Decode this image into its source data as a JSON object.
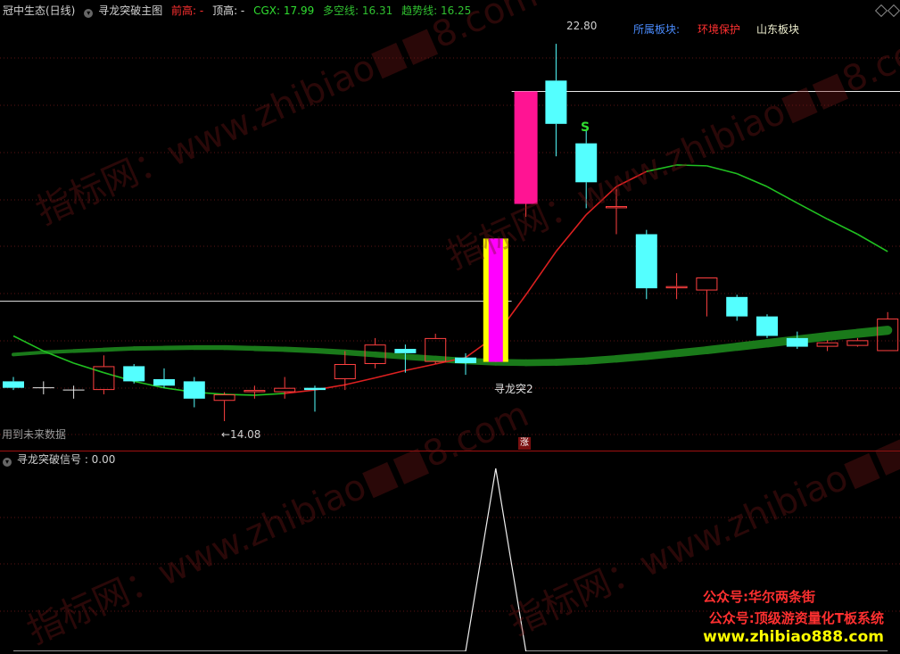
{
  "header": {
    "stock_name": "冠中生态(日线)",
    "indicator_name": "寻龙突破主图",
    "prev_high": "前高: -",
    "top_high": "顶高: -",
    "cgx": "CGX: 17.99",
    "long_short": "多空线: 16.31",
    "trend": "趋势线: 16.25"
  },
  "sectors": {
    "label": "所属板块:",
    "items": [
      "环境保护",
      "山东板块"
    ]
  },
  "main_panel": {
    "future_note": "用到未来数据",
    "high_label": "22.80",
    "low_label": "←14.08",
    "signal_label": "寻龙突2",
    "s_mark": "S",
    "zhang_mark": "涨"
  },
  "sub_panel": {
    "title": "寻龙突破信号 : 0.00"
  },
  "promo": {
    "line1": "公众号:华尔两条街",
    "line2": "公众号:顶级游资量化T板系统",
    "line3": "www.zhibiao888.com"
  },
  "watermarks": [
    "指标网：www.zhibiao■■8.com",
    "指标网：www.zhibiao■■8.com",
    "指标网：www.zhibiao■■8.com",
    "指标网：www.zhibiao■■8.com"
  ],
  "colors": {
    "up": "#ff4040",
    "down": "#54ffff",
    "pink": "#ff1493",
    "yellow": "#ffff00",
    "magenta": "#ff00ff",
    "trend_green": "#1a7a1a",
    "line_red": "#dd2020",
    "line_green": "#20c020"
  },
  "chart_data": {
    "type": "candlestick",
    "price_axis": {
      "min": 13.4,
      "max": 23.4
    },
    "candles": [
      {
        "o": 15.0,
        "h": 15.1,
        "l": 14.8,
        "c": 14.85,
        "color": "down"
      },
      {
        "o": 14.88,
        "h": 15.0,
        "l": 14.7,
        "c": 14.85,
        "color": "cross"
      },
      {
        "o": 14.85,
        "h": 14.9,
        "l": 14.6,
        "c": 14.8,
        "color": "cross"
      },
      {
        "o": 14.8,
        "h": 15.6,
        "l": 14.7,
        "c": 15.35,
        "color": "up"
      },
      {
        "o": 15.35,
        "h": 15.4,
        "l": 14.95,
        "c": 15.0,
        "color": "down"
      },
      {
        "o": 15.05,
        "h": 15.3,
        "l": 14.85,
        "c": 14.9,
        "color": "down"
      },
      {
        "o": 15.0,
        "h": 15.1,
        "l": 14.4,
        "c": 14.6,
        "color": "down"
      },
      {
        "o": 14.55,
        "h": 14.75,
        "l": 14.08,
        "c": 14.7,
        "color": "up"
      },
      {
        "o": 14.75,
        "h": 14.9,
        "l": 14.6,
        "c": 14.8,
        "color": "up"
      },
      {
        "o": 14.85,
        "h": 15.1,
        "l": 14.6,
        "c": 14.75,
        "color": "up"
      },
      {
        "o": 14.85,
        "h": 14.9,
        "l": 14.3,
        "c": 14.8,
        "color": "down"
      },
      {
        "o": 15.05,
        "h": 15.7,
        "l": 14.8,
        "c": 15.4,
        "color": "up"
      },
      {
        "o": 15.4,
        "h": 16.0,
        "l": 15.3,
        "c": 15.85,
        "color": "up"
      },
      {
        "o": 15.75,
        "h": 15.85,
        "l": 15.2,
        "c": 15.65,
        "color": "down"
      },
      {
        "o": 15.45,
        "h": 16.1,
        "l": 15.4,
        "c": 16.0,
        "color": "up"
      },
      {
        "o": 15.55,
        "h": 15.65,
        "l": 15.15,
        "c": 15.42,
        "color": "down"
      },
      {
        "o": 15.45,
        "h": 18.3,
        "l": 15.45,
        "c": 18.3,
        "color": "breakout"
      },
      {
        "o": 19.1,
        "h": 21.7,
        "l": 18.8,
        "c": 21.7,
        "color": "pink"
      },
      {
        "o": 21.95,
        "h": 22.8,
        "l": 20.2,
        "c": 20.95,
        "color": "down"
      },
      {
        "o": 20.5,
        "h": 20.8,
        "l": 19.0,
        "c": 19.6,
        "color": "down"
      },
      {
        "o": 19.05,
        "h": 19.45,
        "l": 18.4,
        "c": 19.0,
        "color": "up"
      },
      {
        "o": 18.4,
        "h": 18.5,
        "l": 16.9,
        "c": 17.15,
        "color": "down"
      },
      {
        "o": 17.15,
        "h": 17.5,
        "l": 16.9,
        "c": 17.2,
        "color": "up"
      },
      {
        "o": 17.1,
        "h": 17.4,
        "l": 16.5,
        "c": 17.4,
        "color": "up"
      },
      {
        "o": 16.95,
        "h": 17.0,
        "l": 16.4,
        "c": 16.5,
        "color": "down"
      },
      {
        "o": 16.5,
        "h": 16.55,
        "l": 16.0,
        "c": 16.05,
        "color": "down"
      },
      {
        "o": 16.0,
        "h": 16.15,
        "l": 15.75,
        "c": 15.8,
        "color": "down"
      },
      {
        "o": 15.8,
        "h": 15.95,
        "l": 15.7,
        "c": 15.9,
        "color": "up"
      },
      {
        "o": 15.82,
        "h": 16.0,
        "l": 15.8,
        "c": 15.95,
        "color": "up"
      },
      {
        "o": 15.7,
        "h": 16.6,
        "l": 15.7,
        "c": 16.45,
        "color": "up"
      }
    ],
    "trend_line": [
      15.62,
      15.67,
      15.7,
      15.73,
      15.76,
      15.77,
      15.78,
      15.78,
      15.76,
      15.74,
      15.71,
      15.67,
      15.62,
      15.57,
      15.52,
      15.47,
      15.44,
      15.43,
      15.44,
      15.47,
      15.52,
      15.58,
      15.65,
      15.72,
      15.8,
      15.88,
      15.96,
      16.04,
      16.11,
      16.18
    ],
    "cgx_line": [
      16.05,
      15.7,
      15.42,
      15.2,
      15.0,
      14.85,
      14.75,
      14.7,
      14.68,
      14.72,
      14.8,
      14.92,
      15.08,
      15.25,
      15.4,
      15.55,
      16.05,
      17.0,
      18.0,
      18.85,
      19.5,
      19.85,
      20.0,
      19.98,
      19.8,
      19.5,
      19.12,
      18.75,
      18.4,
      18.0
    ],
    "cgx_red_until_index": 21,
    "signal_series": [
      0,
      0,
      0,
      0,
      0,
      0,
      0,
      0,
      0,
      0,
      0,
      0,
      0,
      0,
      0,
      0,
      1,
      0,
      0,
      0,
      0,
      0,
      0,
      0,
      0,
      0,
      0,
      0,
      0,
      0
    ],
    "reference_lines": [
      {
        "price": 21.7,
        "from_index": 17
      },
      {
        "price": 16.85,
        "to_index": 17
      }
    ]
  }
}
